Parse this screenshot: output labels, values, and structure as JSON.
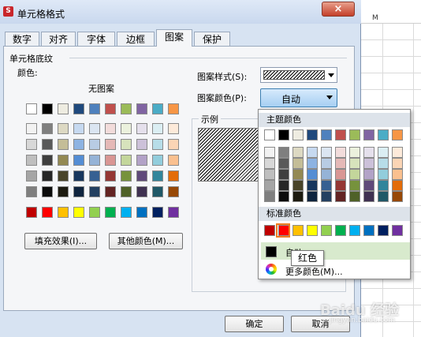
{
  "dialog": {
    "title": "单元格格式",
    "close_label": "×",
    "tabs": [
      {
        "label": "数字",
        "active": false
      },
      {
        "label": "对齐",
        "active": false
      },
      {
        "label": "字体",
        "active": false
      },
      {
        "label": "边框",
        "active": false
      },
      {
        "label": "图案",
        "active": true
      },
      {
        "label": "保护",
        "active": false
      }
    ],
    "group_label": "单元格底纹",
    "color_label": "颜色:",
    "no_pattern_label": "无图案",
    "fill_effect_button": "填充效果(I)...",
    "other_colors_button": "其他颜色(M)...",
    "pattern_style_label": "图案样式(S):",
    "pattern_color_label": "图案颜色(P):",
    "pattern_color_value": "自动",
    "sample_label": "示例",
    "ok_button": "确定",
    "cancel_button": "取消"
  },
  "spreadsheet": {
    "column_header": "M"
  },
  "popup": {
    "theme_header": "主题颜色",
    "standard_header": "标准颜色",
    "auto_label": "自动",
    "more_colors_label": "更多颜色(M)...",
    "tooltip": "红色"
  },
  "palette": {
    "theme_row": [
      "#ffffff",
      "#000000",
      "#eeece1",
      "#1f497d",
      "#4f81bd",
      "#c0504d",
      "#9bbb59",
      "#8064a2",
      "#4bacc6",
      "#f79646"
    ],
    "tint_rows": [
      [
        "#f2f2f2",
        "#7f7f7f",
        "#ddd9c3",
        "#c6d9f0",
        "#dbe5f1",
        "#f2dcdb",
        "#ebf1dd",
        "#e5e0ec",
        "#dbeef3",
        "#fdeada"
      ],
      [
        "#d8d8d8",
        "#595959",
        "#c4bd97",
        "#8db3e2",
        "#b8cce4",
        "#e5b9b7",
        "#d7e3bc",
        "#ccc1d9",
        "#b7dde8",
        "#fbd5b5"
      ],
      [
        "#bfbfbf",
        "#3f3f3f",
        "#938953",
        "#548dd4",
        "#95b3d7",
        "#d99694",
        "#c3d69b",
        "#b2a2c7",
        "#92cddc",
        "#fac08f"
      ],
      [
        "#a5a5a5",
        "#262626",
        "#494429",
        "#17365d",
        "#366092",
        "#953734",
        "#76923c",
        "#5f497a",
        "#31859b",
        "#e36c09"
      ],
      [
        "#7f7f7f",
        "#0c0c0c",
        "#1d1b10",
        "#0f243e",
        "#244061",
        "#632423",
        "#4f6128",
        "#3f3151",
        "#205867",
        "#974806"
      ]
    ],
    "standard_row": [
      "#c00000",
      "#ff0000",
      "#ffc000",
      "#ffff00",
      "#92d050",
      "#00b050",
      "#00b0f0",
      "#0070c0",
      "#002060",
      "#7030a0"
    ],
    "selected_color": "#ff0000"
  },
  "watermark": {
    "text": "Baidu 经验",
    "sub": "jingyan.baidu.com"
  }
}
